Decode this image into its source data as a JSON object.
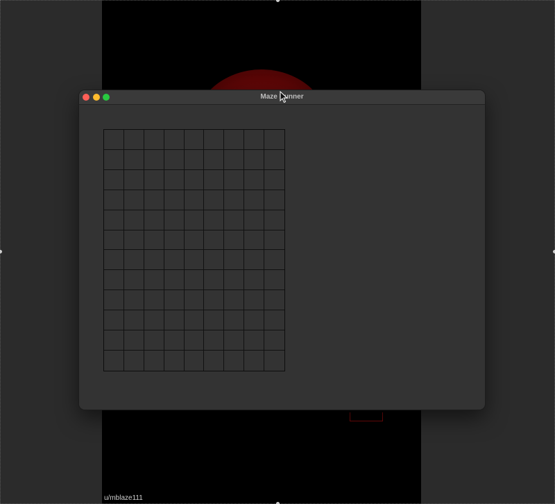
{
  "window": {
    "title": "Maze Runner"
  },
  "maze": {
    "rows": 12,
    "cols": 9
  },
  "overlay": {
    "username": "u/mblaze111"
  },
  "colors": {
    "background": "#2b2b2b",
    "video_strip": "#000000",
    "window_bg": "#333333",
    "grid_line": "#111111",
    "close": "#ff5f57",
    "minimize": "#febc2e",
    "maximize": "#28c840"
  },
  "icons": [
    "close-icon",
    "minimize-icon",
    "maximize-icon",
    "pointer-cursor-icon"
  ]
}
